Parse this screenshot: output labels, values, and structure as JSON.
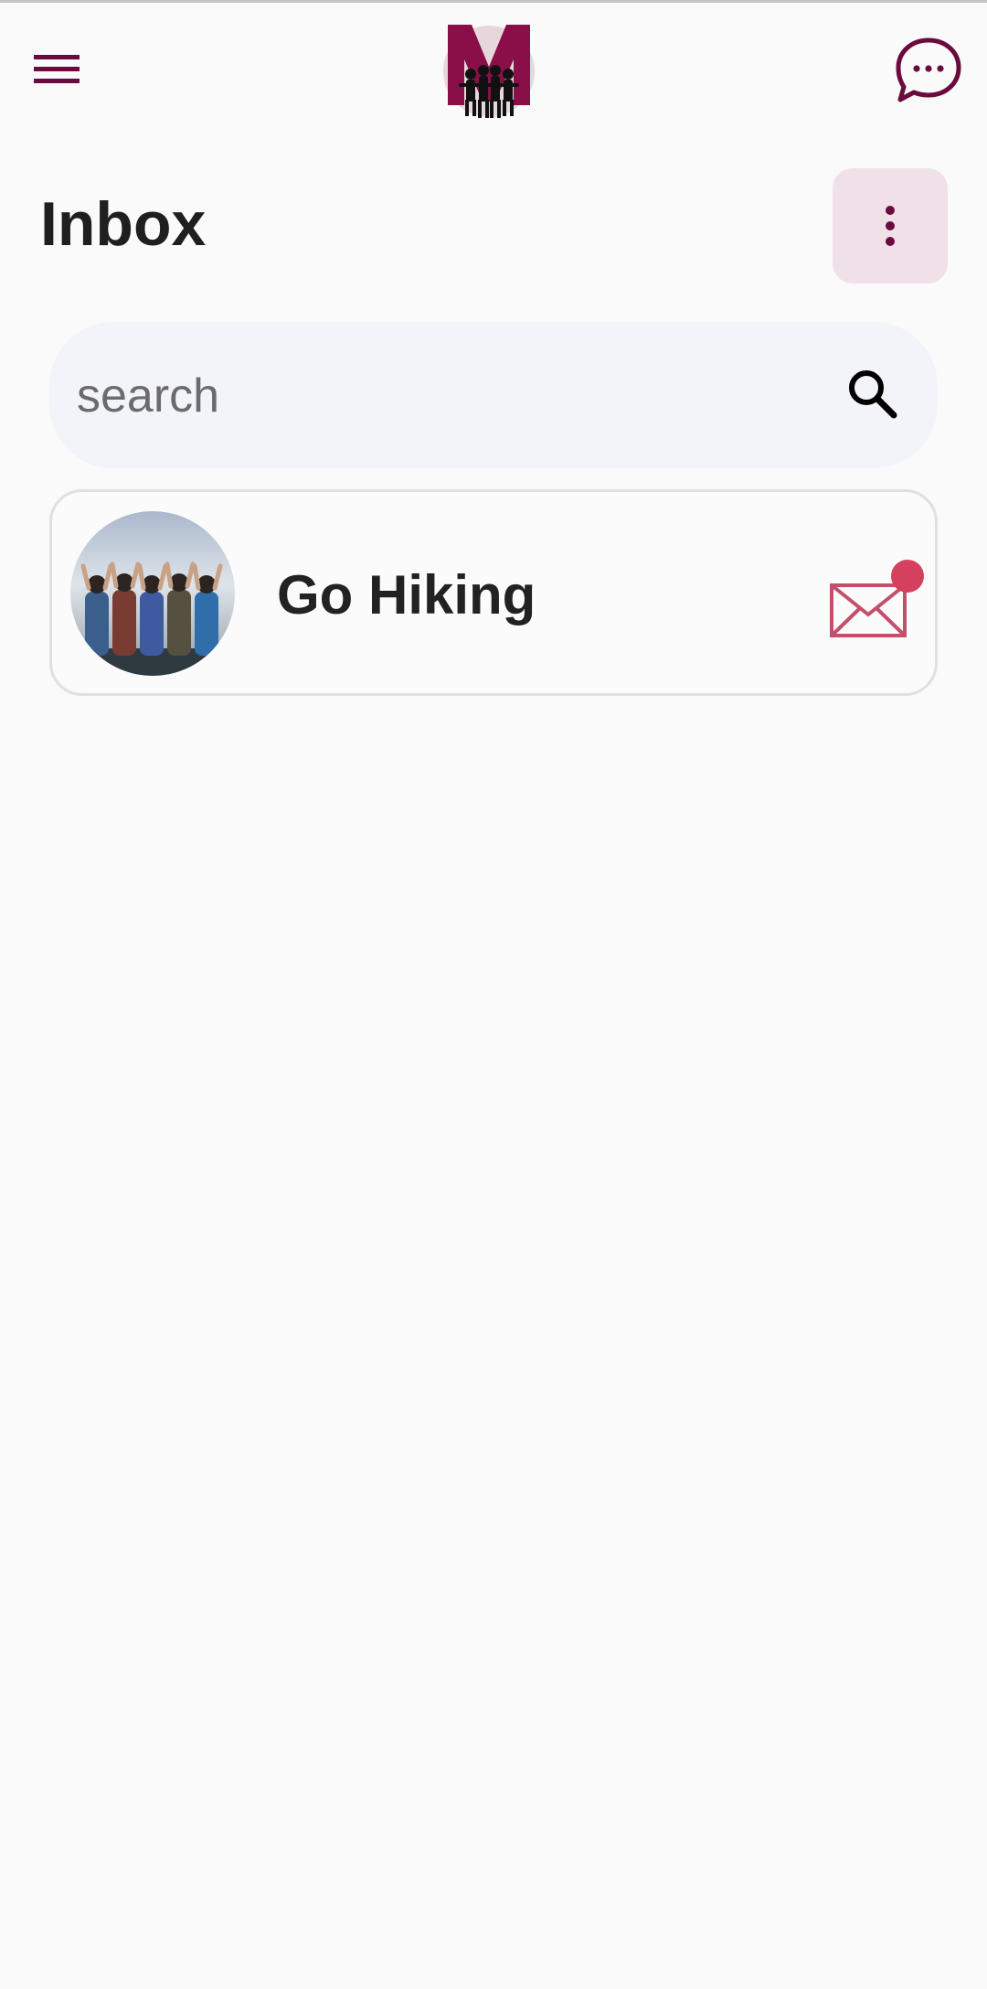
{
  "app_bar": {
    "menu_icon": "hamburger-menu-icon",
    "logo_letter": "M",
    "chat_icon": "chat-bubble-icon"
  },
  "page": {
    "title": "Inbox",
    "more_icon": "vertical-dots-icon"
  },
  "search": {
    "placeholder": "search",
    "value": "",
    "icon": "search-icon"
  },
  "conversations": [
    {
      "name": "Go Hiking",
      "avatar": "group-hikers-photo",
      "unread": true,
      "icon": "envelope-icon"
    }
  ],
  "colors": {
    "brand": "#6b0a3c",
    "accent_light": "#f0e0e8",
    "unread_dot": "#d4405e",
    "envelope": "#c44f6a"
  }
}
